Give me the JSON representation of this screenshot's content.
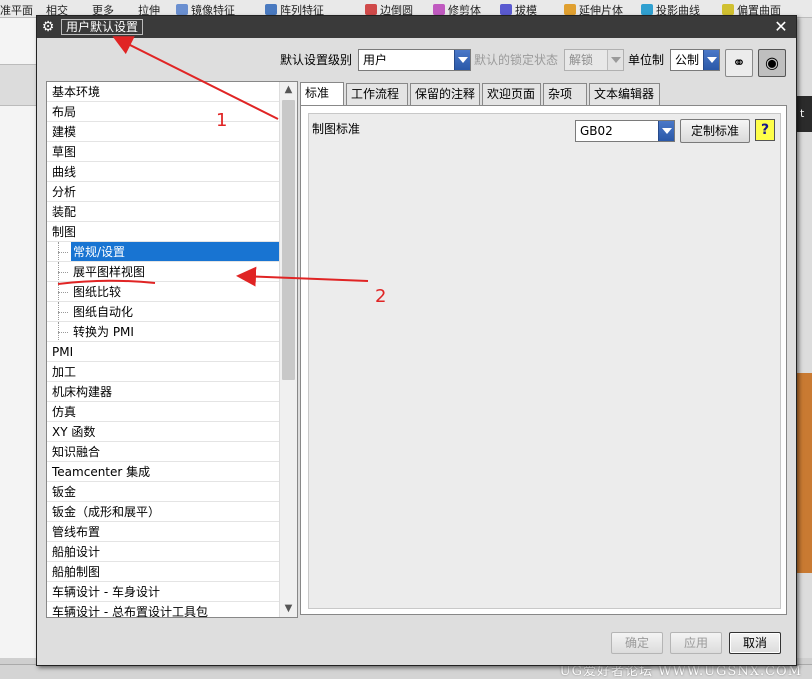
{
  "app_toolbar": {
    "items": [
      "准平面",
      "相交",
      "更多",
      "拉伸",
      "镜像特征",
      "阵列特征",
      "边倒圆",
      "修剪体",
      "拔模",
      "延伸片体",
      "投影曲线",
      "偏置曲面"
    ]
  },
  "watermark": "UG爱好者论坛 WWW.UGSNX.COM",
  "dialog": {
    "title": "用户默认设置",
    "settings_level_label": "默认设置级别",
    "settings_level_value": "用户",
    "lock_state_label": "默认的锁定状态",
    "lock_state_value": "解锁",
    "unit_label": "单位制",
    "unit_value": "公制"
  },
  "tree": {
    "items": [
      {
        "label": "基本环境",
        "level": 0
      },
      {
        "label": "布局",
        "level": 0
      },
      {
        "label": "建模",
        "level": 0
      },
      {
        "label": "草图",
        "level": 0
      },
      {
        "label": "曲线",
        "level": 0
      },
      {
        "label": "分析",
        "level": 0
      },
      {
        "label": "装配",
        "level": 0
      },
      {
        "label": "制图",
        "level": 0
      },
      {
        "label": "常规/设置",
        "level": 1,
        "selected": true
      },
      {
        "label": "展平图样视图",
        "level": 1
      },
      {
        "label": "图纸比较",
        "level": 1
      },
      {
        "label": "图纸自动化",
        "level": 1
      },
      {
        "label": "转换为 PMI",
        "level": 1
      },
      {
        "label": "PMI",
        "level": 0
      },
      {
        "label": "加工",
        "level": 0
      },
      {
        "label": "机床构建器",
        "level": 0
      },
      {
        "label": "仿真",
        "level": 0
      },
      {
        "label": "XY 函数",
        "level": 0
      },
      {
        "label": "知识融合",
        "level": 0
      },
      {
        "label": "Teamcenter 集成",
        "level": 0
      },
      {
        "label": "钣金",
        "level": 0
      },
      {
        "label": "钣金（成形和展平）",
        "level": 0
      },
      {
        "label": "管线布置",
        "level": 0
      },
      {
        "label": "船舶设计",
        "level": 0
      },
      {
        "label": "船舶制图",
        "level": 0
      },
      {
        "label": "车辆设计 - 车身设计",
        "level": 0
      },
      {
        "label": "车辆设计 - 总布置设计工具包",
        "level": 0
      }
    ]
  },
  "tabs": [
    {
      "label": "标准",
      "active": true
    },
    {
      "label": "工作流程"
    },
    {
      "label": "保留的注释"
    },
    {
      "label": "欢迎页面"
    },
    {
      "label": "杂项"
    },
    {
      "label": "文本编辑器"
    }
  ],
  "panel": {
    "standard_label": "制图标准",
    "standard_value": "GB02",
    "custom_button": "定制标准",
    "help_icon": "?"
  },
  "buttons": {
    "ok": "确定",
    "apply": "应用",
    "cancel": "取消"
  },
  "annotations": {
    "label_1": "1",
    "label_2": "2",
    "color": "#e02424"
  },
  "colors": {
    "selection": "#1874d2",
    "title_bar": "#3a3a3a"
  }
}
